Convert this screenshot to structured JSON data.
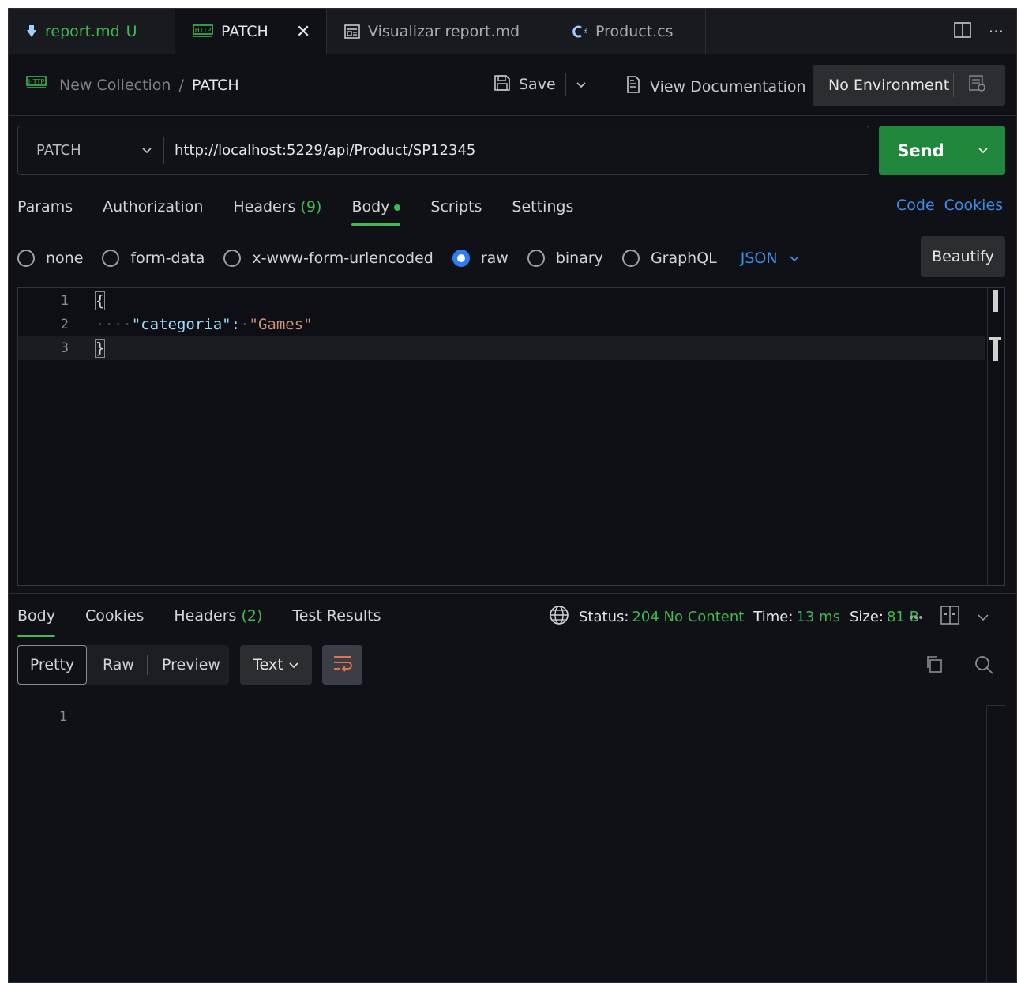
{
  "tabs": [
    {
      "label": "report.md",
      "badge": "U",
      "icon": "markdown-icon",
      "color": "#3fb950"
    },
    {
      "label": "PATCH",
      "icon": "http-icon",
      "unsaved": true
    },
    {
      "label": "Visualizar report.md",
      "icon": "preview-icon"
    },
    {
      "label": "Product.cs",
      "icon": "csharp-icon"
    }
  ],
  "tabbar_actions": {
    "split_icon": "split-editor-icon",
    "more": "···"
  },
  "breadcrumb": {
    "collection": "New Collection",
    "separator": "/",
    "current": "PATCH"
  },
  "toolbar": {
    "save_label": "Save",
    "doc_label": "View Documentation",
    "environment": "No Environment"
  },
  "request": {
    "method": "PATCH",
    "url": "http://localhost:5229/api/Product/SP12345",
    "send_label": "Send"
  },
  "request_tabs": {
    "params": "Params",
    "authorization": "Authorization",
    "headers": "Headers",
    "headers_count": "(9)",
    "body": "Body",
    "scripts": "Scripts",
    "settings": "Settings",
    "code": "Code",
    "cookies": "Cookies"
  },
  "body_types": {
    "none": "none",
    "form_data": "form-data",
    "urlencoded": "x-www-form-urlencoded",
    "raw": "raw",
    "binary": "binary",
    "graphql": "GraphQL",
    "selected": "raw",
    "format": "JSON",
    "beautify": "Beautify"
  },
  "editor": {
    "lines": [
      {
        "n": "1",
        "text": "{"
      },
      {
        "n": "2",
        "key": "\"categoria\"",
        "colon": ":",
        "value": "\"Games\""
      },
      {
        "n": "3",
        "text": "}"
      }
    ]
  },
  "response_tabs": {
    "body": "Body",
    "cookies": "Cookies",
    "headers": "Headers",
    "headers_count": "(2)",
    "test_results": "Test Results"
  },
  "response_status": {
    "status_label": "Status:",
    "status": "204 No Content",
    "time_label": "Time:",
    "time": "13 ms",
    "size_label": "Size:",
    "size": "81 B"
  },
  "response_view": {
    "pretty": "Pretty",
    "raw": "Raw",
    "preview": "Preview",
    "format": "Text"
  },
  "response_body": {
    "line_number": "1"
  },
  "colors": {
    "accent_green": "#3fb950",
    "send_green": "#1f883d",
    "link_blue": "#3a8ee6",
    "wrap_orange": "#e0734a"
  }
}
